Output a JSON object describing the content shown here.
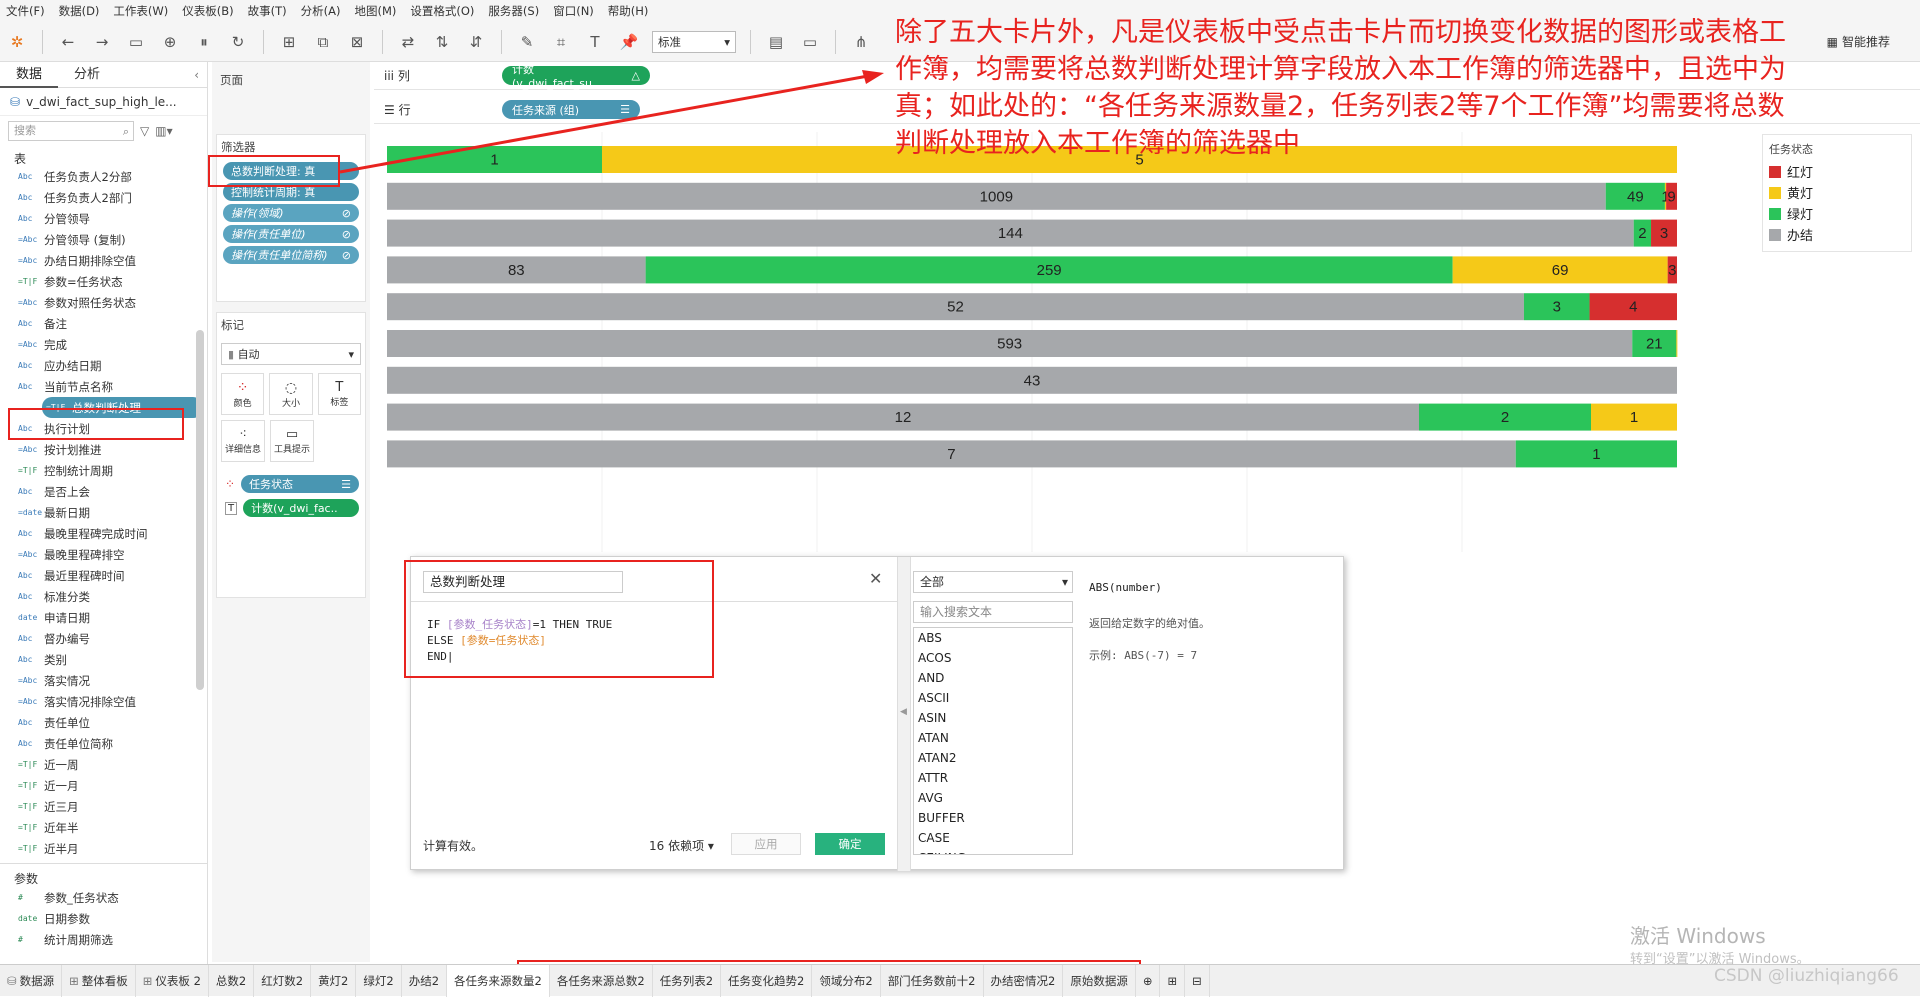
{
  "menu": [
    "文件(F)",
    "数据(D)",
    "工作表(W)",
    "仪表板(B)",
    "故事(T)",
    "分析(A)",
    "地图(M)",
    "设置格式(O)",
    "服务器(S)",
    "窗口(N)",
    "帮助(H)"
  ],
  "toolbar": {
    "fit_select": "标准",
    "smart_recommend": "智能推荐"
  },
  "left_panel": {
    "tabs": [
      "数据",
      "分析"
    ],
    "datasource": "v_dwi_fact_sup_high_le...",
    "search_placeholder": "搜索",
    "tables_header": "表",
    "fields": [
      {
        "type": "Abc",
        "name": "任务负责人2分部"
      },
      {
        "type": "Abc",
        "name": "任务负责人2部门"
      },
      {
        "type": "Abc",
        "name": "分管领导"
      },
      {
        "type": "=Abc",
        "name": "分管领导 (复制)"
      },
      {
        "type": "=Abc",
        "name": "办结日期排除空值"
      },
      {
        "type": "=T|F",
        "name": "参数=任务状态"
      },
      {
        "type": "=Abc",
        "name": "参数对照任务状态"
      },
      {
        "type": "Abc",
        "name": "备注"
      },
      {
        "type": "=Abc",
        "name": "完成"
      },
      {
        "type": "Abc",
        "name": "应办结日期"
      },
      {
        "type": "Abc",
        "name": "当前节点名称"
      },
      {
        "type": "=T|F",
        "name": "总数判断处理",
        "selected": true
      },
      {
        "type": "Abc",
        "name": "执行计划"
      },
      {
        "type": "=Abc",
        "name": "按计划推进"
      },
      {
        "type": "=T|F",
        "name": "控制统计周期"
      },
      {
        "type": "Abc",
        "name": "是否上会"
      },
      {
        "type": "=date",
        "name": "最新日期"
      },
      {
        "type": "Abc",
        "name": "最晚里程碑完成时间"
      },
      {
        "type": "=Abc",
        "name": "最晚里程碑排空"
      },
      {
        "type": "Abc",
        "name": "最近里程碑时间"
      },
      {
        "type": "Abc",
        "name": "标准分类"
      },
      {
        "type": "date",
        "name": "申请日期"
      },
      {
        "type": "Abc",
        "name": "督办编号"
      },
      {
        "type": "Abc",
        "name": "类别"
      },
      {
        "type": "=Abc",
        "name": "落实情况"
      },
      {
        "type": "=Abc",
        "name": "落实情况排除空值"
      },
      {
        "type": "Abc",
        "name": "责任单位"
      },
      {
        "type": "Abc",
        "name": "责任单位简称"
      },
      {
        "type": "=T|F",
        "name": "近一周"
      },
      {
        "type": "=T|F",
        "name": "近一月"
      },
      {
        "type": "=T|F",
        "name": "近三月"
      },
      {
        "type": "=T|F",
        "name": "近年半"
      },
      {
        "type": "=T|F",
        "name": "近半月"
      }
    ],
    "params_header": "参数",
    "params": [
      {
        "type": "#",
        "name": "参数_任务状态"
      },
      {
        "type": "date",
        "name": "日期参数"
      },
      {
        "type": "#",
        "name": "统计周期筛选"
      }
    ]
  },
  "shelves": {
    "pages_label": "页面",
    "filters_label": "筛选器",
    "filters": [
      "总数判断处理: 真",
      "控制统计周期: 真",
      "操作(领域)",
      "操作(责任单位)",
      "操作(责任单位简称)"
    ],
    "marks_label": "标记",
    "marks_type": "自动",
    "marks_buttons": [
      "颜色",
      "大小",
      "标签",
      "详细信息",
      "工具提示"
    ],
    "marks_pills": [
      "任务状态",
      "计数(v_dwi_fac.."
    ],
    "columns_label": "列",
    "columns_pill": "计数(v_dwi_fact_su..",
    "rows_label": "行",
    "rows_pill": "任务来源 (组)"
  },
  "colors": {
    "red": "#d62f2f",
    "yellow": "#f5c918",
    "green": "#2bc45a",
    "gray": "#a6a8ab",
    "accent_red": "#e8231f"
  },
  "chart_data": {
    "type": "bar",
    "orientation": "horizontal-stacked-100",
    "rows": [
      [
        {
          "s": "绿灯",
          "v": 1
        },
        {
          "s": "黄灯",
          "v": 5
        }
      ],
      [
        {
          "s": "办结",
          "v": 1009
        },
        {
          "s": "绿灯",
          "v": 49
        },
        {
          "s": "黄灯",
          "v": 1
        },
        {
          "s": "红灯",
          "v": 9
        }
      ],
      [
        {
          "s": "办结",
          "v": 144
        },
        {
          "s": "绿灯",
          "v": 2
        },
        {
          "s": "红灯",
          "v": 3
        }
      ],
      [
        {
          "s": "办结",
          "v": 83
        },
        {
          "s": "绿灯",
          "v": 259
        },
        {
          "s": "黄灯",
          "v": 69
        },
        {
          "s": "红灯",
          "v": 3
        }
      ],
      [
        {
          "s": "办结",
          "v": 52
        },
        {
          "s": "绿灯",
          "v": 3
        },
        {
          "s": "红灯",
          "v": 4
        }
      ],
      [
        {
          "s": "办结",
          "v": 593
        },
        {
          "s": "绿灯",
          "v": 21
        },
        {
          "s": "黄灯",
          "v": 0.3
        }
      ],
      [
        {
          "s": "办结",
          "v": 43
        }
      ],
      [
        {
          "s": "办结",
          "v": 12
        },
        {
          "s": "绿灯",
          "v": 2
        },
        {
          "s": "黄灯",
          "v": 1
        }
      ],
      [
        {
          "s": "办结",
          "v": 7
        },
        {
          "s": "绿灯",
          "v": 1
        }
      ]
    ],
    "legend": {
      "title": "任务状态",
      "items": [
        "红灯",
        "黄灯",
        "绿灯",
        "办结"
      ]
    }
  },
  "calc": {
    "name": "总数判断处理",
    "line1_kw1": "IF ",
    "line1_param": "[参数_任务状态]",
    "line1_rest": "=1 THEN TRUE",
    "line2_kw": "ELSE ",
    "line2_param": "[参数=任务状态]",
    "line3": "END",
    "valid": "计算有效。",
    "deps": "16 依赖项 ▾",
    "apply": "应用",
    "ok": "确定",
    "fn_category": "全部",
    "fn_search_placeholder": "输入搜索文本",
    "functions": [
      "ABS",
      "ACOS",
      "AND",
      "ASCII",
      "ASIN",
      "ATAN",
      "ATAN2",
      "ATTR",
      "AVG",
      "BUFFER",
      "CASE",
      "CEILING"
    ],
    "fn_signature": "ABS(number)",
    "fn_description": "返回给定数字的绝对值。",
    "fn_example": "示例: ABS(-7) = 7"
  },
  "annotation": "除了五大卡片外，凡是仪表板中受点击卡片而切换变化数据的图形或表格工作簿，均需要将总数判断处理计算字段放入本工作簿的筛选器中，且选中为真；如此处的：“各任务来源数量2，任务列表2等7个工作簿”均需要将总数判断处理放入本工作簿的筛选器中",
  "bottom_tabs": [
    "数据源",
    "整体看板",
    "仪表板 2",
    "总数2",
    "红灯数2",
    "黄灯2",
    "绿灯2",
    "办结2",
    "各任务来源数量2",
    "各任务来源总数2",
    "任务列表2",
    "任务变化趋势2",
    "领域分布2",
    "部门任务数前十2",
    "办结密情况2",
    "原始数据源"
  ],
  "watermarks": {
    "activate": "激活 Windows",
    "activate_sub": "转到“设置”以激活 Windows。",
    "csdn": "CSDN @liuzhiqiang66"
  }
}
